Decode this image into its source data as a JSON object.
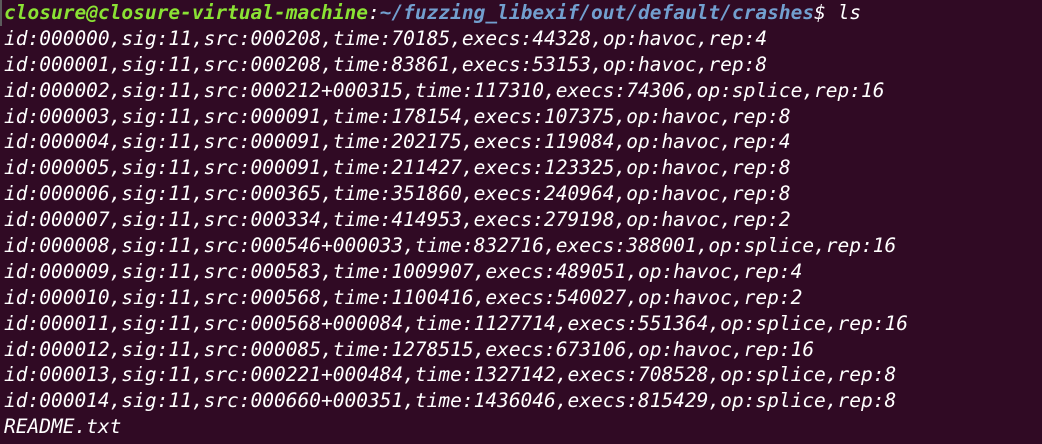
{
  "prompt": {
    "user_host": "closure@closure-virtual-machine",
    "separator": ":",
    "path": "~/fuzzing_libexif/out/default/crashes",
    "symbol": "$",
    "command": " ls"
  },
  "files": [
    "id:000000,sig:11,src:000208,time:70185,execs:44328,op:havoc,rep:4",
    "id:000001,sig:11,src:000208,time:83861,execs:53153,op:havoc,rep:8",
    "id:000002,sig:11,src:000212+000315,time:117310,execs:74306,op:splice,rep:16",
    "id:000003,sig:11,src:000091,time:178154,execs:107375,op:havoc,rep:8",
    "id:000004,sig:11,src:000091,time:202175,execs:119084,op:havoc,rep:4",
    "id:000005,sig:11,src:000091,time:211427,execs:123325,op:havoc,rep:8",
    "id:000006,sig:11,src:000365,time:351860,execs:240964,op:havoc,rep:8",
    "id:000007,sig:11,src:000334,time:414953,execs:279198,op:havoc,rep:2",
    "id:000008,sig:11,src:000546+000033,time:832716,execs:388001,op:splice,rep:16",
    "id:000009,sig:11,src:000583,time:1009907,execs:489051,op:havoc,rep:4",
    "id:000010,sig:11,src:000568,time:1100416,execs:540027,op:havoc,rep:2",
    "id:000011,sig:11,src:000568+000084,time:1127714,execs:551364,op:splice,rep:16",
    "id:000012,sig:11,src:000085,time:1278515,execs:673106,op:havoc,rep:16",
    "id:000013,sig:11,src:000221+000484,time:1327142,execs:708528,op:splice,rep:8",
    "id:000014,sig:11,src:000660+000351,time:1436046,execs:815429,op:splice,rep:8",
    "README.txt"
  ],
  "colors": {
    "background": "#300a24",
    "prompt_user": "#8ae234",
    "prompt_path": "#729fcf",
    "text": "#ffffff"
  }
}
